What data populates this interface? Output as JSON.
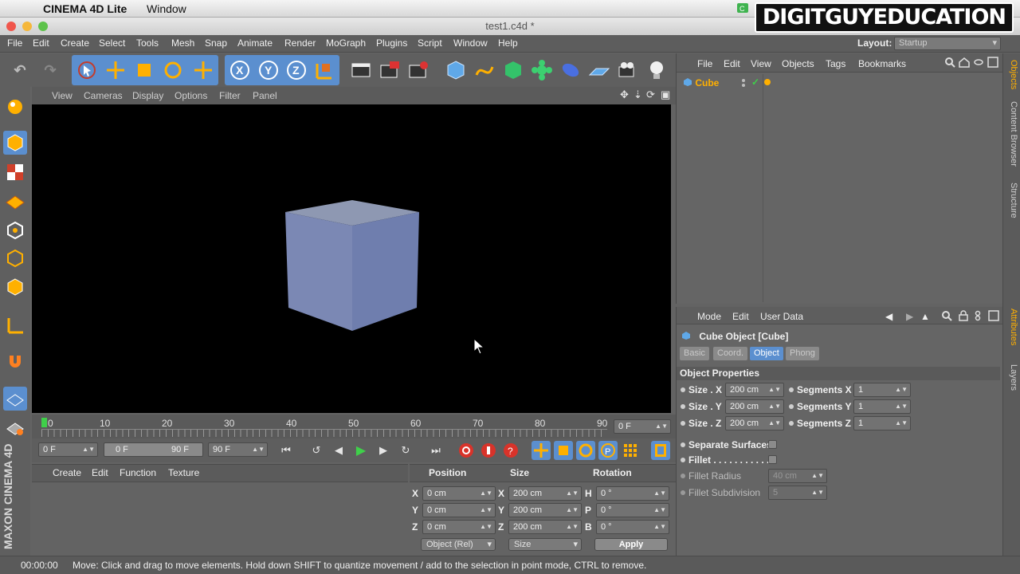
{
  "mac_menubar": {
    "app_name": "CINEMA 4D Lite",
    "menus": [
      "Window"
    ]
  },
  "brand_overlay": "DIGITGUYEDUCATION",
  "window": {
    "title": "test1.c4d *"
  },
  "app_menu": {
    "items": [
      "File",
      "Edit",
      "Create",
      "Select",
      "Tools",
      "Mesh",
      "Snap",
      "Animate",
      "Render",
      "MoGraph",
      "Plugins",
      "Script",
      "Window",
      "Help"
    ],
    "layout_label": "Layout:",
    "layout_value": "Startup"
  },
  "toolbar": {
    "axis_x": "X",
    "axis_y": "Y",
    "axis_z": "Z"
  },
  "viewport": {
    "menu": [
      "View",
      "Cameras",
      "Display",
      "Options",
      "Filter",
      "Panel"
    ]
  },
  "timeline": {
    "ticks": [
      "0",
      "10",
      "20",
      "30",
      "40",
      "50",
      "60",
      "70",
      "80",
      "90"
    ],
    "current_frame": "0 F",
    "start_frame": "0 F",
    "range_start": "0 F",
    "range_end": "90 F",
    "end_frame": "90 F"
  },
  "material_manager": {
    "menu": [
      "Create",
      "Edit",
      "Function",
      "Texture"
    ]
  },
  "coordinates": {
    "headers": {
      "position": "Position",
      "size": "Size",
      "rotation": "Rotation"
    },
    "rows": [
      {
        "axis": "X",
        "pos": "0 cm",
        "size_axis": "X",
        "size": "200 cm",
        "rot_axis": "H",
        "rot": "0 °"
      },
      {
        "axis": "Y",
        "pos": "0 cm",
        "size_axis": "Y",
        "size": "200 cm",
        "rot_axis": "P",
        "rot": "0 °"
      },
      {
        "axis": "Z",
        "pos": "0 cm",
        "size_axis": "Z",
        "size": "200 cm",
        "rot_axis": "B",
        "rot": "0 °"
      }
    ],
    "mode_dropdown": "Object (Rel)",
    "size_dropdown": "Size",
    "apply_label": "Apply"
  },
  "object_manager": {
    "menu": [
      "File",
      "Edit",
      "View",
      "Objects",
      "Tags",
      "Bookmarks"
    ],
    "objects": [
      {
        "name": "Cube"
      }
    ]
  },
  "attribute_manager": {
    "menu": [
      "Mode",
      "Edit",
      "User Data"
    ],
    "object_title": "Cube Object [Cube]",
    "tabs": [
      "Basic",
      "Coord.",
      "Object",
      "Phong"
    ],
    "active_tab": "Object",
    "section": "Object Properties",
    "props": {
      "size_x_label": "Size . X",
      "size_x": "200 cm",
      "size_y_label": "Size . Y",
      "size_y": "200 cm",
      "size_z_label": "Size . Z",
      "size_z": "200 cm",
      "seg_x_label": "Segments X",
      "seg_x": "1",
      "seg_y_label": "Segments Y",
      "seg_y": "1",
      "seg_z_label": "Segments Z",
      "seg_z": "1",
      "separate_label": "Separate Surfaces",
      "fillet_label": "Fillet . . . . . . . . . . . .",
      "fillet_radius_label": "Fillet Radius",
      "fillet_radius": "40 cm",
      "fillet_sub_label": "Fillet Subdivision",
      "fillet_sub": "5"
    }
  },
  "side_tabs": [
    "Objects",
    "Content Browser",
    "Structure",
    "Attributes",
    "Layers"
  ],
  "statusbar": {
    "time": "00:00:00",
    "message": "Move: Click and drag to move elements. Hold down SHIFT to quantize movement / add to the selection in point mode, CTRL to remove."
  },
  "maxon_logo": "MAXON CINEMA 4D",
  "colors": {
    "accent_blue": "#5b8fcf",
    "active_orange": "#ffb000",
    "play_green": "#3fd04a"
  }
}
